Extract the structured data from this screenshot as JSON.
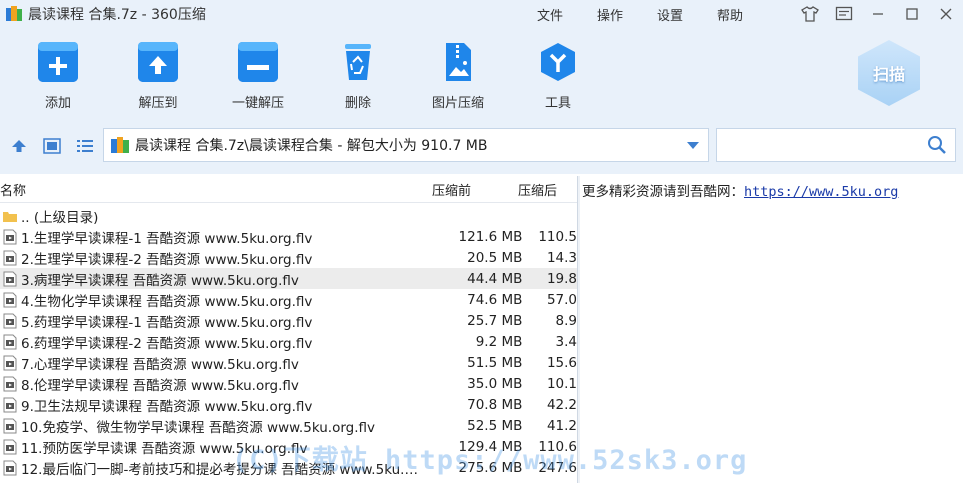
{
  "window": {
    "title": "晨读课程 合集.7z - 360压缩",
    "menus": [
      "文件",
      "操作",
      "设置",
      "帮助"
    ]
  },
  "toolbar": {
    "add": "添加",
    "extract_to": "解压到",
    "one_click": "一键解压",
    "delete": "删除",
    "image_compress": "图片压缩",
    "tools": "工具",
    "scan": "扫描"
  },
  "address": {
    "path": "晨读课程 合集.7z\\晨读课程合集 - 解包大小为 910.7 MB"
  },
  "list": {
    "headers": {
      "name": "名称",
      "packed": "压缩前",
      "size": "压缩后"
    },
    "parent": ".. (上级目录)",
    "rows": [
      {
        "name": "1.生理学早读课程-1 吾酷资源 www.5ku.org.flv",
        "packed": "121.6 MB",
        "size": "110.5"
      },
      {
        "name": "2.生理学早读课程-2 吾酷资源 www.5ku.org.flv",
        "packed": "20.5 MB",
        "size": "14.3"
      },
      {
        "name": "3.病理学早读课程 吾酷资源 www.5ku.org.flv",
        "packed": "44.4 MB",
        "size": "19.8"
      },
      {
        "name": "4.生物化学早读课程 吾酷资源 www.5ku.org.flv",
        "packed": "74.6 MB",
        "size": "57.0"
      },
      {
        "name": "5.药理学早读课程-1 吾酷资源 www.5ku.org.flv",
        "packed": "25.7 MB",
        "size": "8.9"
      },
      {
        "name": "6.药理学早读课程-2 吾酷资源 www.5ku.org.flv",
        "packed": "9.2 MB",
        "size": "3.4"
      },
      {
        "name": "7.心理学早读课程 吾酷资源 www.5ku.org.flv",
        "packed": "51.5 MB",
        "size": "15.6"
      },
      {
        "name": "8.伦理学早读课程 吾酷资源 www.5ku.org.flv",
        "packed": "35.0 MB",
        "size": "10.1"
      },
      {
        "name": "9.卫生法规早读课程 吾酷资源 www.5ku.org.flv",
        "packed": "70.8 MB",
        "size": "42.2"
      },
      {
        "name": "10.免疫学、微生物学早读课程 吾酷资源 www.5ku.org.flv",
        "packed": "52.5 MB",
        "size": "41.2"
      },
      {
        "name": "11.预防医学早读课 吾酷资源 www.5ku.org.flv",
        "packed": "129.4 MB",
        "size": "110.6"
      },
      {
        "name": "12.最后临门一脚-考前技巧和提必考提分课 吾酷资源 www.5ku.o...",
        "packed": "275.6 MB",
        "size": "247.6"
      }
    ]
  },
  "comment": {
    "text": "更多精彩资源请到吾酷网：",
    "link": "https://www.5ku.org"
  },
  "watermark": "(C)下载站 https://www.52sk3.org",
  "colors": {
    "chrome_bg": "#e9f1fa",
    "accent_blue": "#1677e0",
    "selected_row": "#ececec",
    "link": "#1a3aa8"
  }
}
